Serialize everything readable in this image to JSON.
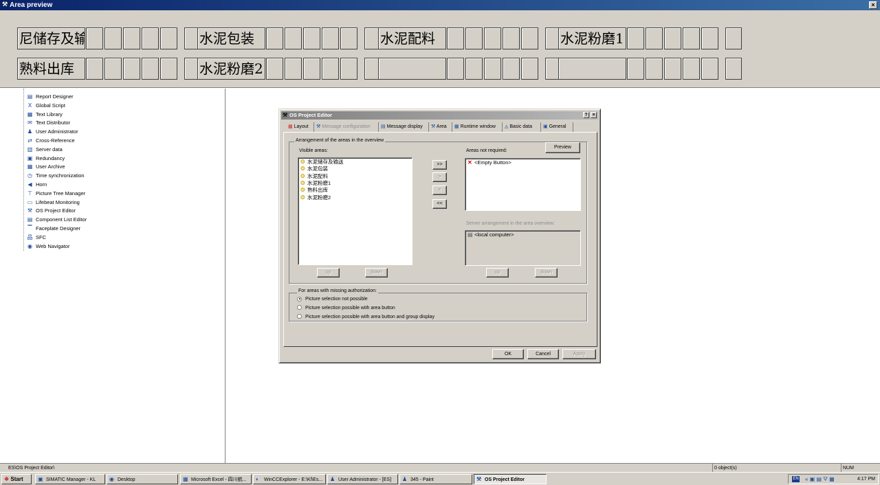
{
  "area_preview": {
    "title": "Area preview",
    "close": "×",
    "row1": [
      "尼储存及输",
      "水泥包装",
      "水泥配料",
      "水泥粉磨1"
    ],
    "row2": [
      "熟料出库",
      "水泥粉磨2",
      "",
      ""
    ]
  },
  "tree": {
    "items": [
      {
        "label": "Report Designer",
        "icon": "report-icon"
      },
      {
        "label": "Global Script",
        "icon": "script-icon"
      },
      {
        "label": "Text Library",
        "icon": "text-library-icon"
      },
      {
        "label": "Text Distributor",
        "icon": "text-distributor-icon"
      },
      {
        "label": "User Administrator",
        "icon": "user-admin-icon"
      },
      {
        "label": "Cross-Reference",
        "icon": "cross-reference-icon"
      },
      {
        "label": "Server data",
        "icon": "server-data-icon"
      },
      {
        "label": "Redundancy",
        "icon": "redundancy-icon"
      },
      {
        "label": "User Archive",
        "icon": "user-archive-icon"
      },
      {
        "label": "Time synchronization",
        "icon": "clock-icon"
      },
      {
        "label": "Horn",
        "icon": "horn-icon"
      },
      {
        "label": "Picture Tree Manager",
        "icon": "picture-tree-icon"
      },
      {
        "label": "Lifebeat Monitoring",
        "icon": "lifebeat-icon"
      },
      {
        "label": "OS Project Editor",
        "icon": "os-project-icon"
      },
      {
        "label": "Component List Editor",
        "icon": "component-list-icon"
      },
      {
        "label": "Faceplate Designer",
        "icon": "faceplate-icon"
      },
      {
        "label": "SFC",
        "icon": "sfc-icon"
      },
      {
        "label": "Web Navigator",
        "icon": "web-navigator-icon"
      }
    ]
  },
  "dialog": {
    "title": "OS Project Editor",
    "help_btn": "?",
    "close_btn": "×",
    "tabs": [
      "Layout",
      "Message configuration",
      "Message display",
      "Area",
      "Runtime window",
      "Basic data",
      "General"
    ],
    "active_tab": "Area",
    "group_arrangement": "Arrangement of the areas in the overview",
    "visible_areas_label": "Visible areas:",
    "visible_areas": [
      "水泥储存及输送",
      "水泥包装",
      "水泥配料",
      "水泥粉磨1",
      "熟料出库",
      "水泥粉磨2"
    ],
    "not_required_label": "Areas not required:",
    "not_required": [
      "<Empty Button>"
    ],
    "preview_btn": "Preview",
    "move_btns": [
      ">>",
      ">",
      "<",
      "<<"
    ],
    "server_label": "Server arrangement in the area overview:",
    "server_items": [
      "<local computer>"
    ],
    "up": "up",
    "down": "down",
    "group_missing": "For areas with missing authorization:",
    "radios": [
      {
        "label": "Picture selection not possible",
        "checked": true
      },
      {
        "label": "Picture selection possible with area button",
        "checked": false
      },
      {
        "label": "Picture selection possible with area button and group display",
        "checked": false
      }
    ],
    "ok": "OK",
    "cancel": "Cancel",
    "apply": "Apply"
  },
  "status": {
    "path": "ES\\OS Project Editor\\",
    "objects": "0 object(s)",
    "num": "NUM"
  },
  "taskbar": {
    "start": "Start",
    "items": [
      "SIMATIC Manager - KL",
      "Desktop",
      "Microsoft Excel - 四川航...",
      "WinCCExplorer - E:\\Kl\\Es...",
      "User Administrator - [ES]",
      "345 - Paint",
      "OS Project Editor"
    ],
    "lang": "EN",
    "clock": "4:17 PM"
  }
}
